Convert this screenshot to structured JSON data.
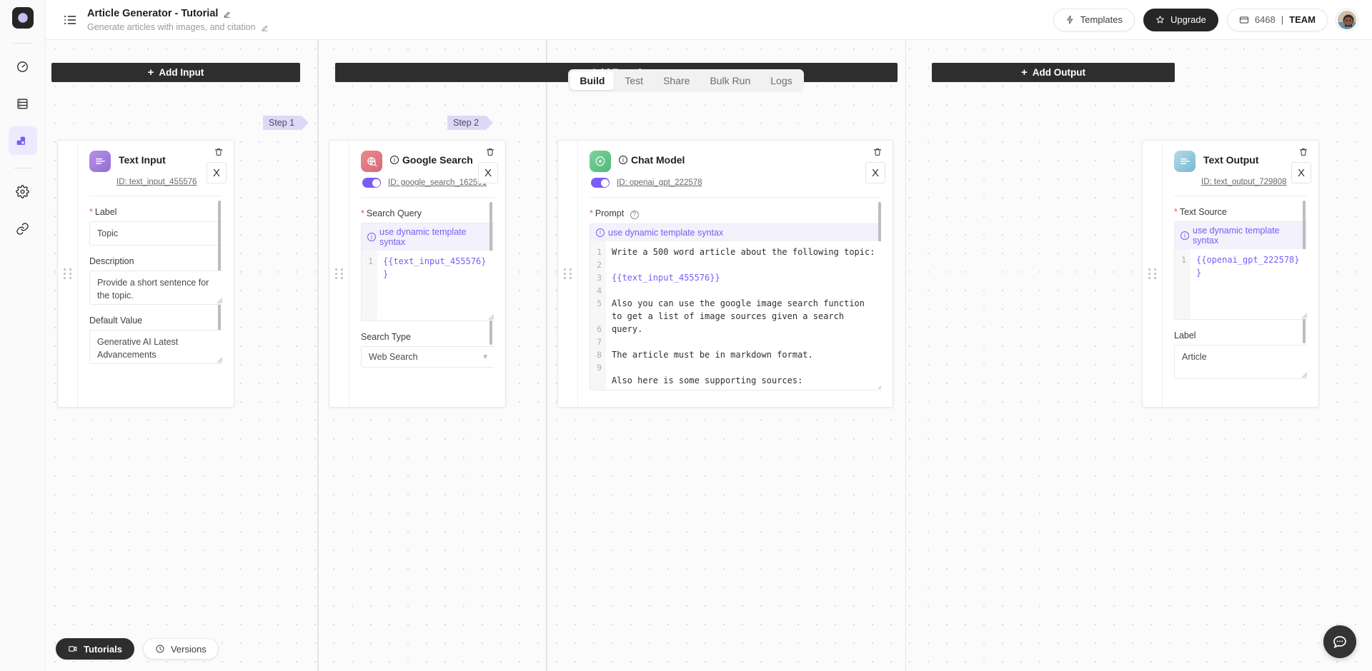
{
  "app": {
    "header": {
      "menu_icon": "list-view-icon",
      "title": "Article Generator - Tutorial",
      "subtitle": "Generate articles with images, and citation",
      "templates_label": "Templates",
      "templates_icon": "lightning-icon",
      "upgrade_label": "Upgrade",
      "upgrade_icon": "star-icon",
      "credits_value": "6468",
      "credits_separator": "|",
      "plan_label": "TEAM",
      "credits_icon": "card-icon",
      "avatar_name": "user-avatar"
    },
    "sidebar": {
      "items": [
        {
          "name": "logo",
          "icon": "moon-logo-icon",
          "active": false
        },
        {
          "name": "dashboard",
          "icon": "gauge-icon",
          "active": false
        },
        {
          "name": "datasets",
          "icon": "database-icon",
          "active": false
        },
        {
          "name": "apps",
          "icon": "blocks-icon",
          "active": true
        },
        {
          "name": "settings",
          "icon": "gear-icon",
          "active": false
        },
        {
          "name": "integrations",
          "icon": "link-icon",
          "active": false
        }
      ]
    },
    "tabs": [
      {
        "label": "Build",
        "active": true
      },
      {
        "label": "Test",
        "active": false
      },
      {
        "label": "Share",
        "active": false
      },
      {
        "label": "Bulk Run",
        "active": false
      },
      {
        "label": "Logs",
        "active": false
      }
    ],
    "toolbar": {
      "add_input": "Add Input",
      "add_function": "Add Function",
      "add_output": "Add Output",
      "plus": "+"
    },
    "steps": [
      {
        "label": "Step 1"
      },
      {
        "label": "Step 2"
      }
    ],
    "footer": {
      "tutorials_label": "Tutorials",
      "tutorials_icon": "video-icon",
      "versions_label": "Versions",
      "versions_icon": "history-clock-icon",
      "chat_icon": "chat-bubble-icon"
    },
    "shared": {
      "dynamic_hint": "use dynamic template syntax",
      "close_label": "X",
      "info_glyph": "i",
      "help_glyph": "?"
    },
    "nodes": {
      "text_input": {
        "title": "Text Input",
        "icon": "text-input-icon",
        "id": "ID: text_input_455576",
        "fields": {
          "label_label": "Label",
          "label_value": "Topic",
          "description_label": "Description",
          "description_value": "Provide a short sentence for the topic.",
          "default_label": "Default Value",
          "default_value": "Generative AI Latest Advancements"
        }
      },
      "google_search": {
        "title": "Google Search",
        "icon": "google-search-icon",
        "id": "ID: google_search_162591",
        "enabled": true,
        "fields": {
          "query_label": "Search Query",
          "query_lines": [
            "{{text_input_455576}}"
          ],
          "search_type_label": "Search Type",
          "search_type_value": "Web Search"
        }
      },
      "chat_model": {
        "title": "Chat Model",
        "icon": "openai-icon",
        "id": "ID: openai_gpt_222578",
        "enabled": true,
        "fields": {
          "prompt_label": "Prompt",
          "prompt_lines": [
            "Write a 500 word article about the following topic:",
            "",
            "{{text_input_455576}}",
            "",
            "Also you can use the google image search function to get a list of image sources given a search query.",
            "",
            "The article must be in markdown format.",
            "",
            "Also here is some supporting sources:"
          ]
        }
      },
      "text_output": {
        "title": "Text Output",
        "icon": "text-output-icon",
        "id": "ID: text_output_729808",
        "fields": {
          "source_label": "Text Source",
          "source_lines": [
            "{{openai_gpt_222578}}"
          ],
          "label_label": "Label",
          "label_value": "Article"
        }
      }
    },
    "colors": {
      "accent": "#7c5cf5",
      "dark": "#2e2e2e",
      "step_tag": "#ded8f7"
    }
  }
}
